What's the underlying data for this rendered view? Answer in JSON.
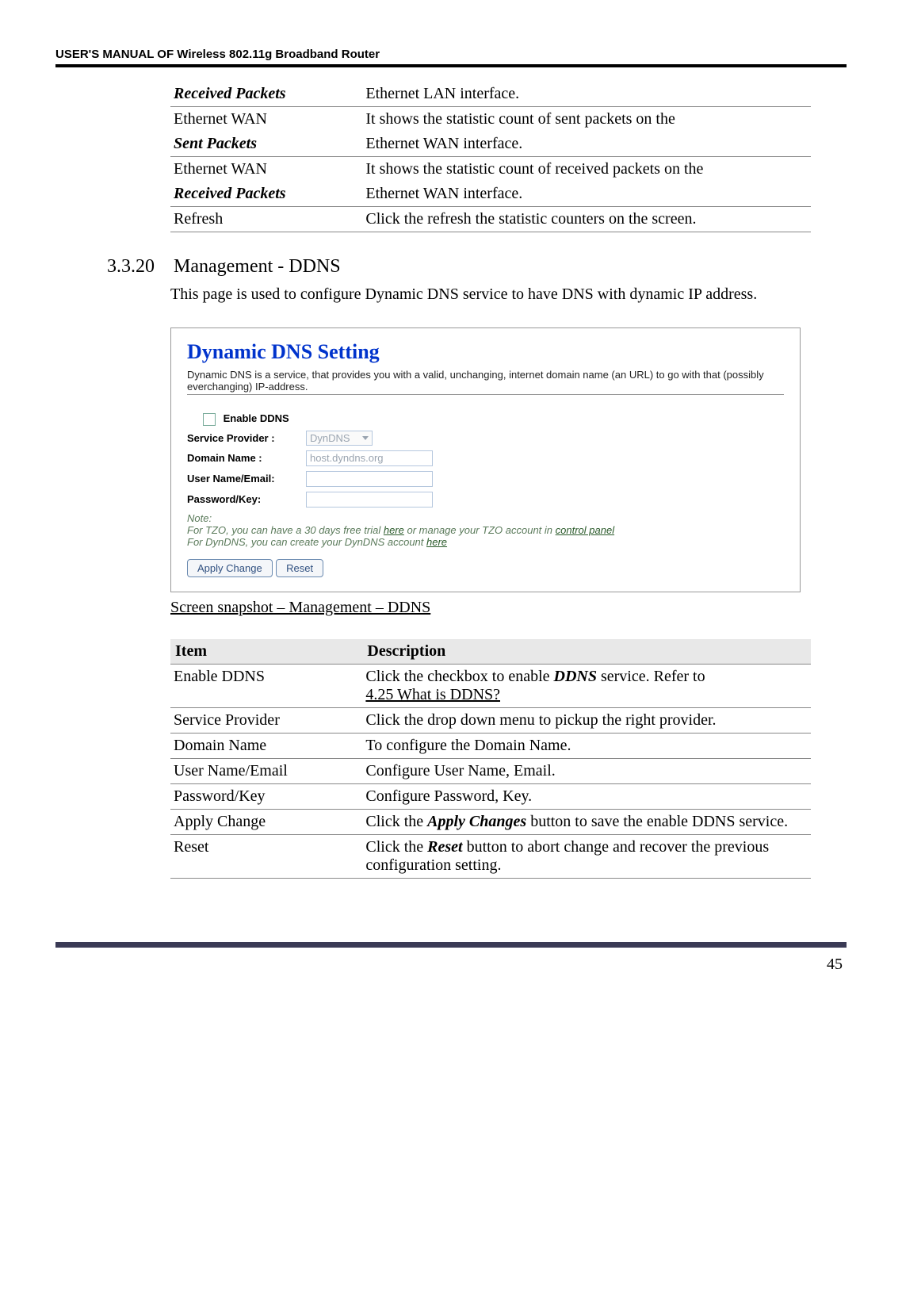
{
  "header": "USER'S MANUAL OF Wireless 802.11g Broadband Router",
  "top_table": {
    "rows": [
      {
        "c1a": "Received Packets",
        "c1a_style": "bold-italic",
        "c2": "Ethernet LAN interface."
      },
      {
        "c1a": "Ethernet WAN",
        "c2": "It shows the statistic count of sent packets on the"
      },
      {
        "c1a": "Sent Packets",
        "c1a_style": "bold-italic",
        "c2": "Ethernet WAN interface."
      },
      {
        "c1a": "Ethernet WAN",
        "c2": "It shows the statistic count of received packets on the"
      },
      {
        "c1a": "Received Packets",
        "c1a_style": "bold-italic",
        "c2": "Ethernet WAN interface."
      },
      {
        "c1a": "Refresh",
        "c2": "Click the refresh the statistic counters on the screen."
      }
    ]
  },
  "section": {
    "num": "3.3.20",
    "title": "Management - DDNS",
    "body": "This page is used to configure Dynamic DNS service to have DNS with dynamic IP address."
  },
  "shot": {
    "title": "Dynamic DNS  Setting",
    "desc": "Dynamic DNS is a service, that provides you with a valid, unchanging, internet domain name (an URL) to go with that (possibly everchanging) IP-address.",
    "enable_label": "Enable DDNS",
    "provider_label": "Service Provider :",
    "provider_value": "DynDNS",
    "domain_label": "Domain Name :",
    "domain_value": "host.dyndns.org",
    "user_label": "User Name/Email:",
    "pass_label": "Password/Key:",
    "note_head": "Note:",
    "note_line1_a": "For TZO, you can have a 30 days free trial ",
    "note_line1_link1": "here",
    "note_line1_b": " or manage your TZO account in ",
    "note_line1_link2": "control panel",
    "note_line2_a": "For DynDNS, you can create your DynDNS account ",
    "note_line2_link": "here",
    "btn_apply": "Apply Change",
    "btn_reset": "Reset"
  },
  "caption": "Screen snapshot – Management – DDNS",
  "defs2": {
    "h1": "Item",
    "h2": "Description",
    "rows": [
      {
        "c1": "Enable DDNS",
        "c2_pre": "Click the checkbox to enable ",
        "c2_bi": "DDNS",
        "c2_post": " service. Refer to ",
        "c2_link": "4.25 What is DDNS?"
      },
      {
        "c1": "Service Provider",
        "c2_plain": "Click the drop down menu to pickup the right provider."
      },
      {
        "c1": "Domain Name",
        "c2_plain": "To configure the Domain Name."
      },
      {
        "c1": "User Name/Email",
        "c2_plain": "Configure User Name, Email."
      },
      {
        "c1": "Password/Key",
        "c2_plain": "Configure Password, Key."
      },
      {
        "c1": "Apply Change",
        "c2_pre": "Click the ",
        "c2_bi": "Apply Changes",
        "c2_post": " button to save the enable DDNS service."
      },
      {
        "c1": "Reset",
        "c2_pre": "Click the ",
        "c2_bi": "Reset",
        "c2_post": " button to abort change and recover the previous configuration setting."
      }
    ]
  },
  "page_num": "45"
}
